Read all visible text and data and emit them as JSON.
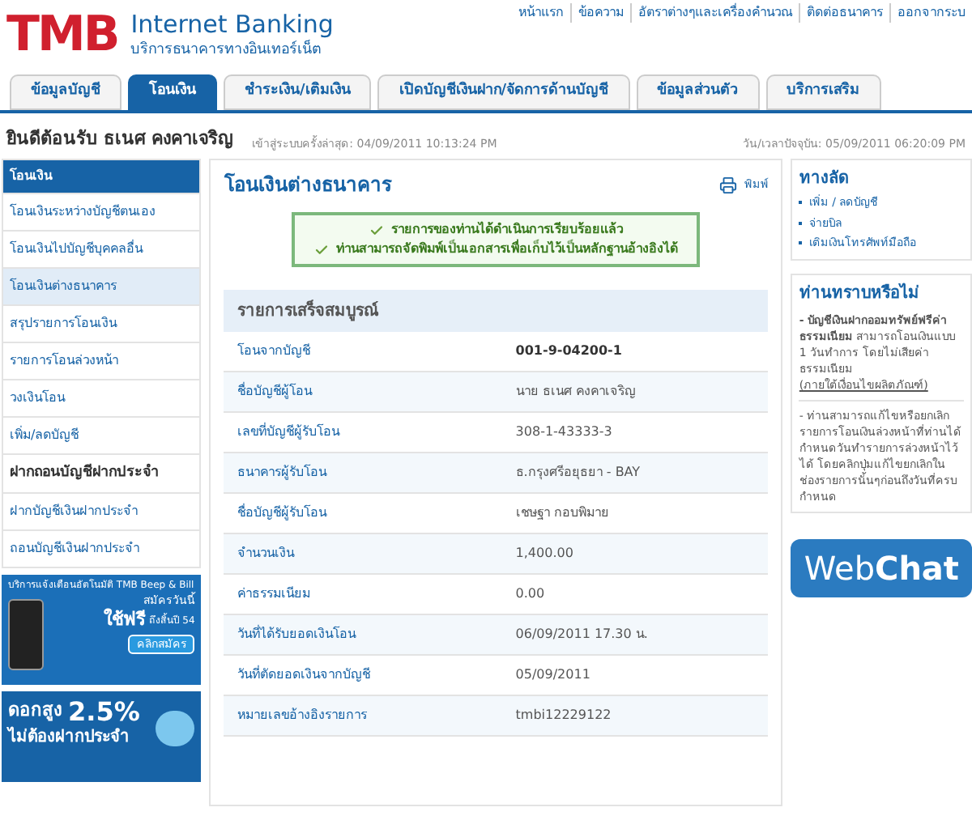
{
  "logo": {
    "mark": "TMB",
    "title": "Internet Banking",
    "subtitle": "บริการธนาคารทางอินเทอร์เน็ต"
  },
  "top_links": [
    "หน้าแรก",
    "ข้อความ",
    "อัตราต่างๆและเครื่องคำนวณ",
    "ติดต่อธนาคาร",
    "ออกจากระบ"
  ],
  "tabs": [
    {
      "label": "ข้อมูลบัญชี",
      "selected": false
    },
    {
      "label": "โอนเงิน",
      "selected": true
    },
    {
      "label": "ชำระเงิน/เติมเงิน",
      "selected": false
    },
    {
      "label": "เปิดบัญชีเงินฝาก/จัดการด้านบัญชี",
      "selected": false
    },
    {
      "label": "ข้อมูลส่วนตัว",
      "selected": false
    },
    {
      "label": "บริการเสริม",
      "selected": false
    }
  ],
  "welcome": {
    "greeting": "ยินดีต้อนรับ ธเนศ คงคาเจริญ",
    "last_login": "เข้าสู่ระบบครั้งล่าสุด: 04/09/2011 10:13:24 PM",
    "now": "วัน/เวลาปัจจุบัน: 05/09/2011 06:20:09 PM"
  },
  "sidebar": [
    {
      "kind": "header",
      "label": "โอนเงิน"
    },
    {
      "kind": "item",
      "label": "โอนเงินระหว่างบัญชีตนเอง",
      "selected": false
    },
    {
      "kind": "item",
      "label": "โอนเงินไปบัญชีบุคคลอื่น",
      "selected": false
    },
    {
      "kind": "item",
      "label": "โอนเงินต่างธนาคาร",
      "selected": true
    },
    {
      "kind": "item",
      "label": "สรุปรายการโอนเงิน",
      "selected": false
    },
    {
      "kind": "item",
      "label": "รายการโอนล่วงหน้า",
      "selected": false
    },
    {
      "kind": "item",
      "label": "วงเงินโอน",
      "selected": false
    },
    {
      "kind": "item",
      "label": "เพิ่ม/ลดบัญชี",
      "selected": false
    },
    {
      "kind": "section",
      "label": "ฝากถอนบัญชีฝากประจำ"
    },
    {
      "kind": "item",
      "label": "ฝากบัญชีเงินฝากประจำ",
      "selected": false
    },
    {
      "kind": "item",
      "label": "ถอนบัญชีเงินฝากประจำ",
      "selected": false
    }
  ],
  "banners": [
    {
      "kind": "beep",
      "lines": [
        "บริการแจ้งเตือนอัตโนมัติ TMB Beep & Bill",
        "สมัครวันนี้",
        "ใช้ฟรี",
        "ถึงสิ้นปี 54"
      ],
      "button": "คลิกสมัคร"
    },
    {
      "kind": "rate",
      "lines": [
        "ดอกสูง",
        "2.5%",
        "ไม่ต้องฝากประจำ"
      ]
    }
  ],
  "main": {
    "title": "โอนเงินต่างธนาคาร",
    "print": "พิมพ์",
    "messages": [
      "รายการของท่านได้ดำเนินการเรียบร้อยแล้ว",
      "ท่านสามารถจัดพิมพ์เป็นเอกสารเพื่อเก็บไว้เป็นหลักฐานอ้างอิงได้"
    ],
    "table_title": "รายการเสร็จสมบูรณ์",
    "rows": [
      {
        "label": "โอนจากบัญชี",
        "value": "001-9-04200-1",
        "bold": true
      },
      {
        "label": "ชื่อบัญชีผู้โอน",
        "value": "นาย ธเนศ คงคาเจริญ",
        "bold": false
      },
      {
        "label": "เลขที่บัญชีผู้รับโอน",
        "value": "308-1-43333-3",
        "bold": false
      },
      {
        "label": "ธนาคารผู้รับโอน",
        "value": "ธ.กรุงศรีอยุธยา - BAY",
        "bold": false
      },
      {
        "label": "ชื่อบัญชีผู้รับโอน",
        "value": "เชษฐา กอบพิมาย",
        "bold": false
      },
      {
        "label": "จำนวนเงิน",
        "value": "1,400.00",
        "bold": false
      },
      {
        "label": "ค่าธรรมเนียม",
        "value": "0.00",
        "bold": false
      },
      {
        "label": "วันที่ได้รับยอดเงินโอน",
        "value": "06/09/2011 17.30 น.",
        "bold": false
      },
      {
        "label": "วันที่ตัดยอดเงินจากบัญชี",
        "value": "05/09/2011",
        "bold": false
      },
      {
        "label": "หมายเลขอ้างอิงรายการ",
        "value": "tmbi12229122",
        "bold": false
      }
    ]
  },
  "shortcuts": {
    "title": "ทางลัด",
    "links": [
      "เพิ่ม / ลดบัญชี",
      "จ่ายบิล",
      "เติมเงินโทรศัพท์มือถือ"
    ]
  },
  "tips": {
    "title": "ท่านทราบหรือไม่",
    "items": [
      {
        "text": "**- บัญชีเงินฝากออมทรัพย์ฟรีค่าธรรมเนียม** สามารถโอนเงินแบบ 1 วันทำการ โดยไม่เสียค่าธรรมเนียม",
        "link": "(ภายใต้เงื่อนไขผลิตภัณฑ์)"
      },
      {
        "text": "- ท่านสามารถแก้ไขหรือยกเลิกรายการโอนเงินล่วงหน้าที่ท่านได้กำหนดวันทำรายการล่วงหน้าไว้ได้ โดยคลิกปุ่มแก้ไขยกเลิกในช่องรายการนั้นๆก่อนถึงวันที่ครบกำหนด"
      }
    ]
  },
  "webchat": [
    "Web",
    "Chat"
  ]
}
